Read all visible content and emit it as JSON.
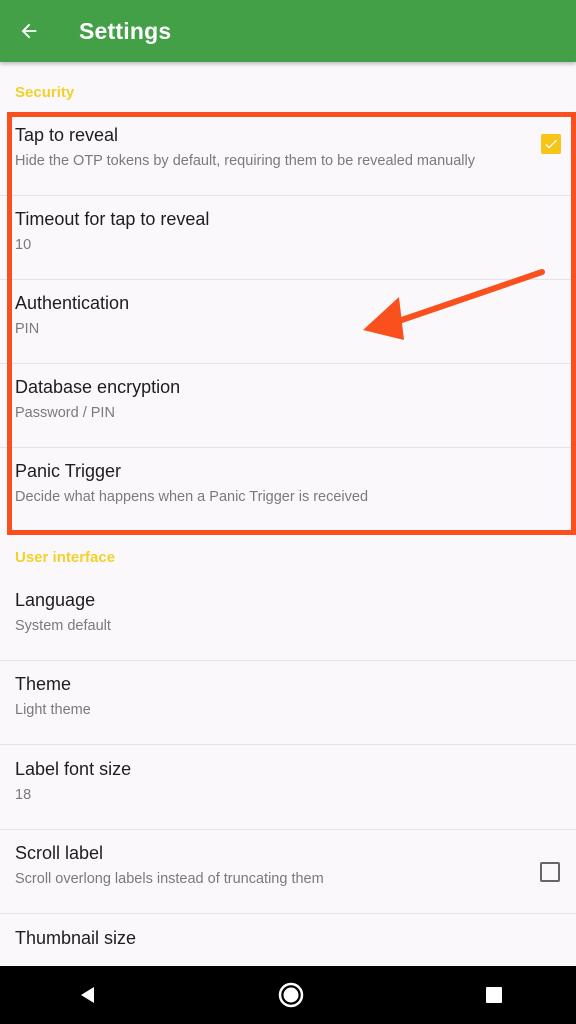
{
  "appbar": {
    "title": "Settings",
    "back_icon": "arrow-back-icon",
    "color": "#43a047"
  },
  "sections": {
    "security": {
      "header": "Security",
      "items": [
        {
          "title": "Tap to reveal",
          "summary": "Hide the OTP tokens by default, requiring them to be revealed manually",
          "checked": true
        },
        {
          "title": "Timeout for tap to reveal",
          "summary": "10"
        },
        {
          "title": "Authentication",
          "summary": "PIN"
        },
        {
          "title": "Database encryption",
          "summary": "Password / PIN"
        },
        {
          "title": "Panic Trigger",
          "summary": "Decide what happens when a Panic Trigger is received"
        }
      ]
    },
    "ui": {
      "header": "User interface",
      "items": [
        {
          "title": "Language",
          "summary": "System default"
        },
        {
          "title": "Theme",
          "summary": "Light theme"
        },
        {
          "title": "Label font size",
          "summary": "18"
        },
        {
          "title": "Scroll label",
          "summary": "Scroll overlong labels instead of truncating them",
          "checked": false
        },
        {
          "title": "Thumbnail size",
          "summary": ""
        }
      ]
    }
  },
  "colors": {
    "accent": "#f2d12b",
    "highlight": "#fa501e",
    "navbar": "#000000"
  },
  "navbar": {
    "icons": [
      "nav-back-icon",
      "nav-home-icon",
      "nav-recents-icon"
    ]
  }
}
